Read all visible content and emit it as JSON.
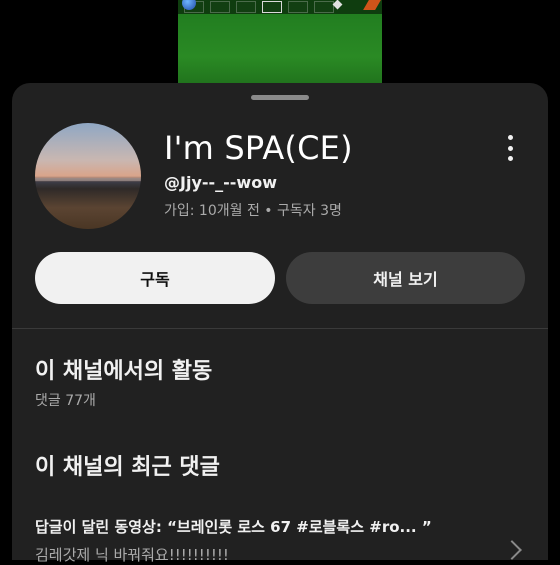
{
  "channel": {
    "name": "I'm SPA(CE)",
    "handle": "@Jjy--_--wow",
    "meta": "가입: 10개월 전 • 구독자 3명"
  },
  "buttons": {
    "subscribe": "구독",
    "view_channel": "채널 보기"
  },
  "activity": {
    "title": "이 채널에서의 활동",
    "comment_count": "댓글 77개"
  },
  "recent_comments": {
    "title": "이 채널의 최근 댓글",
    "items": [
      {
        "video": "답글이 달린 동영상: “브레인롯 로스 67 #로블록스 #ro... ”",
        "text": "김레갓제 닉 바꿔줘요!!!!!!!!!!"
      }
    ]
  },
  "colors": {
    "sheet_bg": "#212121",
    "subscribe_bg": "#f1f1f1",
    "view_bg": "#3d3d3d",
    "secondary_text": "#aaaaaa"
  },
  "icons": [
    "more-vertical-icon",
    "chevron-right-icon"
  ]
}
